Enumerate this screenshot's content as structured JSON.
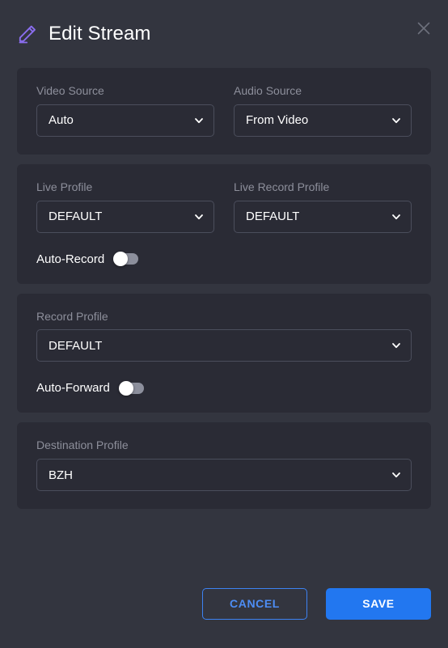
{
  "header": {
    "title": "Edit Stream",
    "edit_icon": "pencil-icon",
    "close_icon": "close-icon",
    "accent_color": "#8b6ef0"
  },
  "cards": [
    {
      "id": "source-card",
      "fields": [
        {
          "label": "Video Source",
          "value": "Auto"
        },
        {
          "label": "Audio Source",
          "value": "From Video"
        }
      ]
    },
    {
      "id": "live-card",
      "fields": [
        {
          "label": "Live Profile",
          "value": "DEFAULT"
        },
        {
          "label": "Live Record Profile",
          "value": "DEFAULT"
        }
      ],
      "toggle": {
        "label": "Auto-Record",
        "on": false
      }
    },
    {
      "id": "record-card",
      "fields": [
        {
          "label": "Record Profile",
          "value": "DEFAULT"
        }
      ],
      "toggle": {
        "label": "Auto-Forward",
        "on": false
      }
    },
    {
      "id": "destination-card",
      "fields": [
        {
          "label": "Destination Profile",
          "value": "BZH"
        }
      ]
    }
  ],
  "footer": {
    "cancel_label": "CANCEL",
    "save_label": "SAVE",
    "primary_color": "#2277f0",
    "outline_color": "#3d82f2"
  },
  "theme": {
    "page_background": "#33353f",
    "card_background": "#2a2b35",
    "border_color": "#4b4e5c",
    "label_color": "#8d8f9b",
    "text_color": "#ffffff"
  }
}
